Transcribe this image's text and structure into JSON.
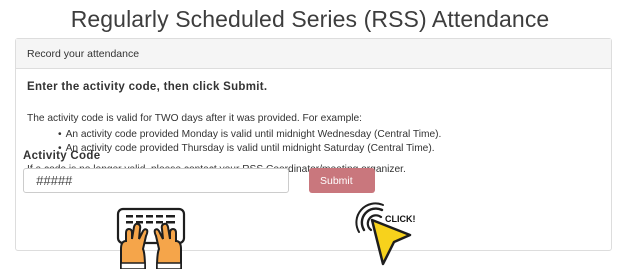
{
  "page": {
    "title": "Regularly Scheduled Series (RSS) Attendance"
  },
  "panel": {
    "heading": "Record your attendance",
    "instruction": "Enter the activity code, then click Submit.",
    "validity_text": "The activity code is valid for TWO days after it was provided. For example:",
    "examples": [
      "An activity code provided Monday is valid until midnight Wednesday (Central Time).",
      "An activity code provided Thursday is valid until midnight Saturday (Central Time)."
    ],
    "contact_text": "If a code is no longer valid, please contact your RSS Coordinator/meeting organizer."
  },
  "form": {
    "code_label": "Activity Code",
    "code_placeholder": "#####",
    "submit_label": "Submit"
  },
  "overlay": {
    "click_text": "CLICK!"
  },
  "colors": {
    "submit_bg": "#c9777d",
    "cursor_fill": "#f7d21c",
    "hands_fill": "#f5a54a"
  },
  "icons": [
    "typing-hands-icon",
    "click-cursor-icon"
  ]
}
